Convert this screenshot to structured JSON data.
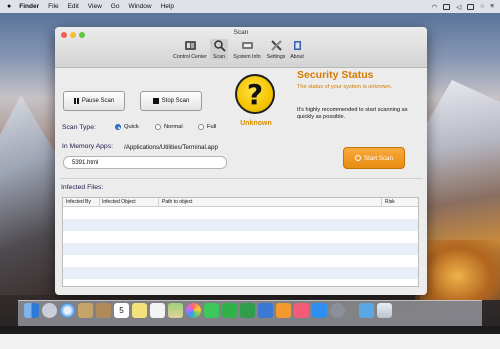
{
  "menubar": {
    "apple": "",
    "items": [
      "Finder",
      "File",
      "Edit",
      "View",
      "Go",
      "Window",
      "Help"
    ]
  },
  "window": {
    "title": "Scan",
    "toolbar": [
      {
        "label": "Control Center",
        "icon": "control-center-icon"
      },
      {
        "label": "Scan",
        "icon": "scan-icon",
        "selected": true
      },
      {
        "label": "System Info",
        "icon": "system-info-icon"
      },
      {
        "label": "Settings",
        "icon": "settings-icon"
      },
      {
        "label": "About",
        "icon": "about-icon"
      }
    ]
  },
  "scan": {
    "pause_label": "Pause Scan",
    "stop_label": "Stop Scan",
    "scan_type_label": "Scan Type:",
    "scan_types": [
      {
        "label": "Quick",
        "selected": true
      },
      {
        "label": "Normal",
        "selected": false
      },
      {
        "label": "Full",
        "selected": false
      }
    ],
    "memory_label": "In Memory Apps:",
    "memory_path": "/Applications/Utilities/Terminal.app",
    "current_file": "5391.html"
  },
  "security": {
    "title": "Security Status",
    "subtitle": "The status of your system is unknown.",
    "body": "It's highly recommended to start scanning as quickly as possible.",
    "status": "Unknown",
    "start_label": "Start Scan",
    "colors": {
      "accent": "#d77a00",
      "shield": "#f5c400"
    }
  },
  "infected": {
    "label": "Infected Files:",
    "columns": [
      "Infected By",
      "Infected Object",
      "Path to object",
      "Risk"
    ],
    "rows": []
  },
  "dock": {
    "icons": [
      "finder-icon",
      "launchpad-icon",
      "safari-icon",
      "mail-icon",
      "contacts-icon",
      "calendar-icon",
      "notes-icon",
      "reminders-icon",
      "maps-icon",
      "photos-icon",
      "messages-icon",
      "facetime-icon",
      "numbers-icon",
      "keynote-icon",
      "books-icon",
      "music-icon",
      "appstore-icon",
      "preferences-icon",
      "downloads-icon",
      "trash-icon"
    ],
    "calendar_day": "5"
  }
}
